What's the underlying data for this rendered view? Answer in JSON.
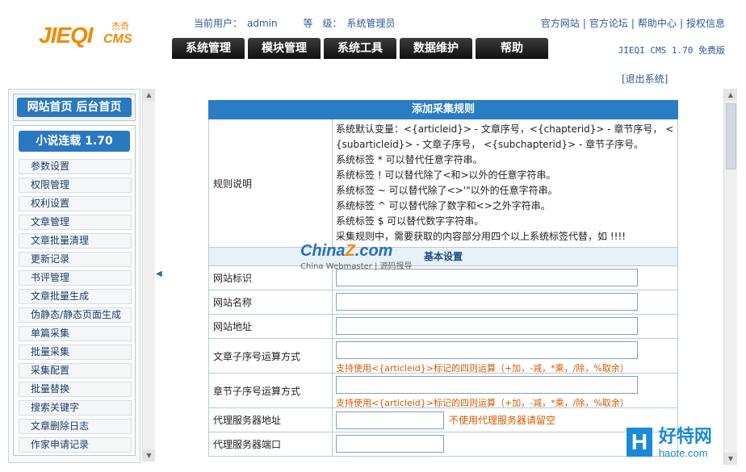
{
  "header": {
    "logo_text": "JIEQI",
    "logo_cms": "CMS",
    "logo_sub": "杰奇",
    "current_user_label": "当前用户：",
    "current_user": "admin",
    "level_label": "等　级：",
    "level": "系统管理员",
    "top_links": [
      "官方网站",
      "官方论坛",
      "帮助中心",
      "授权信息"
    ],
    "version": "JIEQI CMS 1.70 免费版",
    "logout": "[退出系统]"
  },
  "nav": {
    "tabs": [
      "系统管理",
      "模块管理",
      "系统工具",
      "数据维护",
      "帮助"
    ]
  },
  "sidebar": {
    "top_button": "网站首页  后台首页",
    "section_title": "小说连载 1.70",
    "items": [
      "参数设置",
      "权限管理",
      "权利设置",
      "文章管理",
      "文章批量清理",
      "更新记录",
      "书评管理",
      "文章批量生成",
      "伪静态/静态页面生成",
      "单篇采集",
      "批量采集",
      "采集配置",
      "批量替换",
      "搜索关键字",
      "文章删除日志",
      "作家申请记录"
    ]
  },
  "form": {
    "title": "添加采集规则",
    "rule_label": "规则说明",
    "rule_lines": [
      "系统默认变量：<{articleid}> - 文章序号，<{chapterid}> - 章节序号， <",
      "{subarticleid}> - 文章子序号， <{subchapterid}> - 章节子序号。",
      "系统标签 * 可以替代任意字符串。",
      "系统标签 ! 可以替代除了<和>以外的任意字符串。",
      "系统标签 ~ 可以替代除了<>'\"以外的任意字符串。",
      "系统标签 ^ 可以替代除了数字和<>之外字符串。",
      "系统标签 $ 可以替代数字字符串。",
      "采集规则中，需要获取的内容部分用四个以上系统标签代替，如 !!!!"
    ],
    "section_basic": "基本设置",
    "fields": [
      {
        "label": "网站标识",
        "value": ""
      },
      {
        "label": "网站名称",
        "value": ""
      },
      {
        "label": "网站地址",
        "value": ""
      }
    ],
    "article_sub_label": "文章子序号运算方式",
    "article_sub_hint": "支持使用<{articleid}>标记的四则运算（+加，-减，*乘，/除，%取余）",
    "chapter_sub_label": "章节子序号运算方式",
    "chapter_sub_hint": "支持使用<{articleid}>标记的四则运算（+加，-减，*乘，/除，%取余）",
    "proxy_host_label": "代理服务器地址",
    "proxy_host_hint": "不使用代理服务器请留空",
    "proxy_port_label": "代理服务器端口"
  },
  "watermark": {
    "brand_a": "China",
    "brand_b": "Z",
    "brand_c": ".com",
    "sub": "China Webmaster | 源码报导"
  },
  "corner": {
    "h": "H",
    "cn": "好特网",
    "en": "haote.com"
  }
}
